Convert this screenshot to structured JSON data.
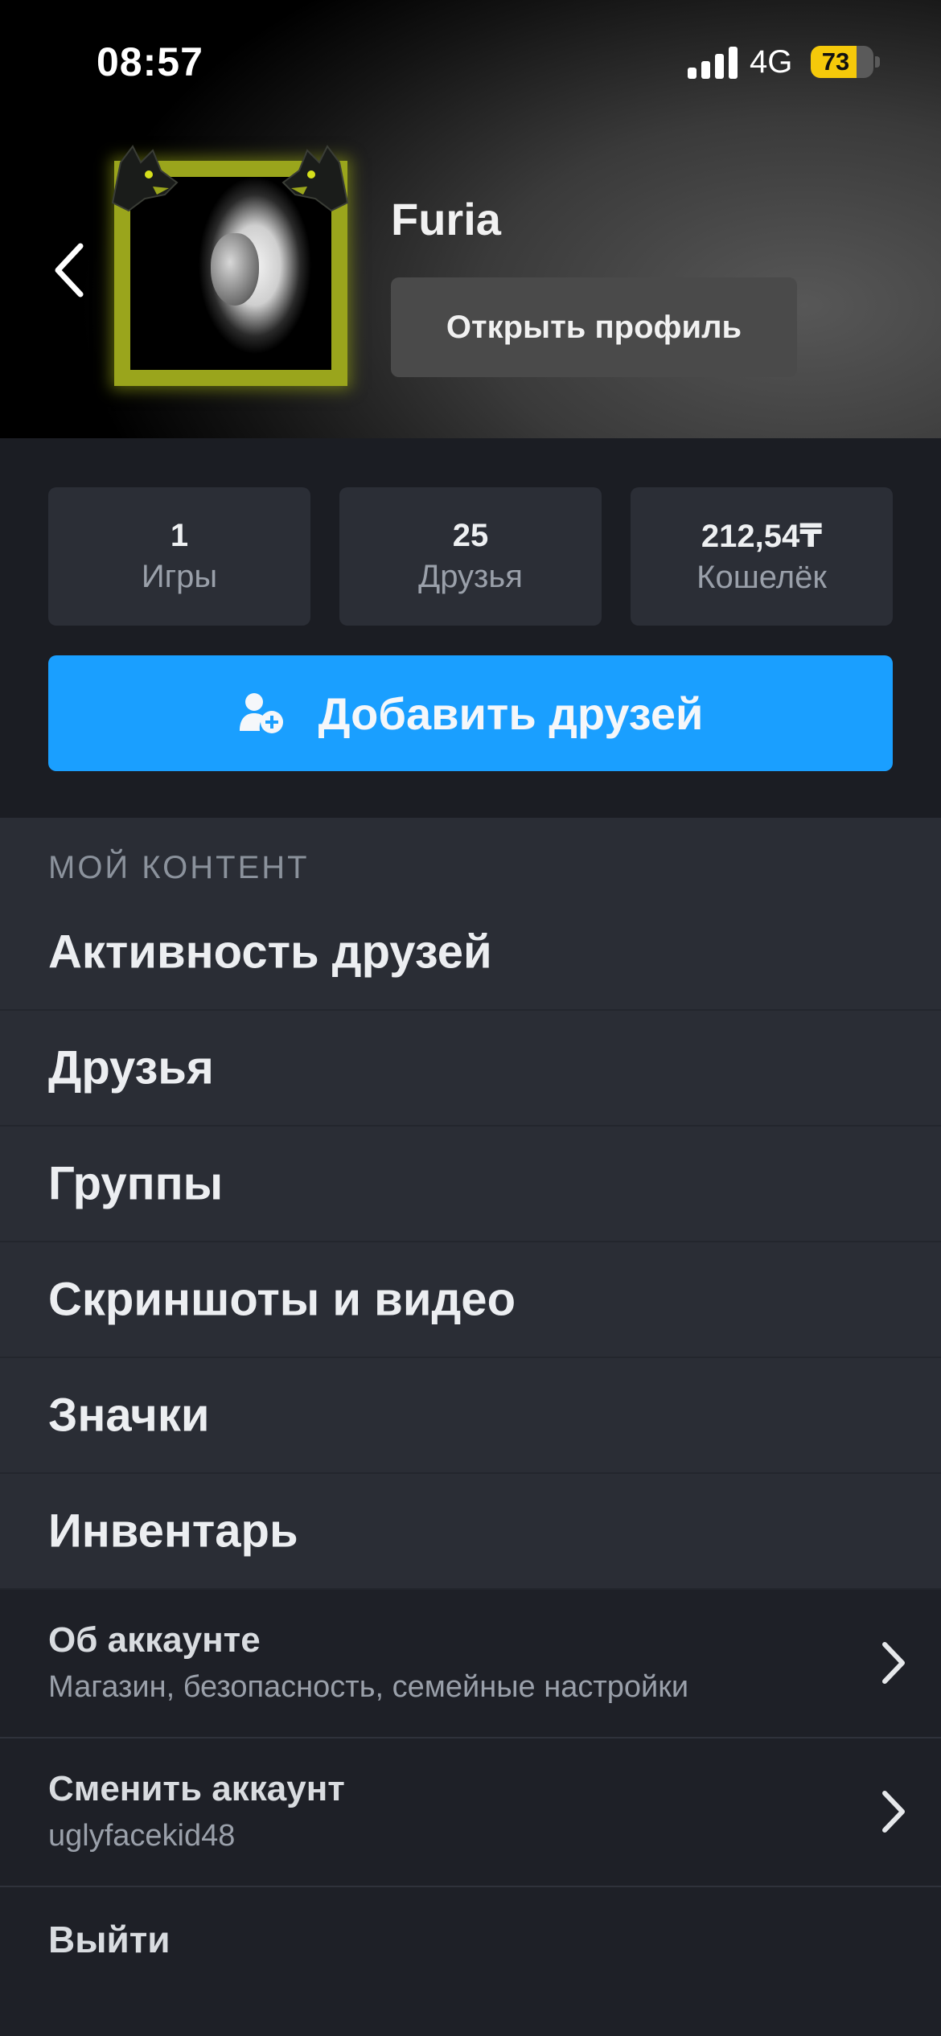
{
  "status_bar": {
    "time": "08:57",
    "network": "4G",
    "battery_percent": "73",
    "battery_level": 0.73
  },
  "profile": {
    "name": "Furia",
    "open_profile_label": "Открыть профиль",
    "frame_color": "#9aa51c"
  },
  "stats": [
    {
      "value": "1",
      "label": "Игры"
    },
    {
      "value": "25",
      "label": "Друзья"
    },
    {
      "value": "212,54₸",
      "label": "Кошелёк"
    }
  ],
  "add_friends": {
    "label": "Добавить друзей",
    "icon": "add-user-icon",
    "color": "#1a9fff"
  },
  "my_content": {
    "title": "МОЙ КОНТЕНТ",
    "items": [
      "Активность друзей",
      "Друзья",
      "Группы",
      "Скриншоты и видео",
      "Значки",
      "Инвентарь"
    ]
  },
  "account": {
    "about_title": "Об аккаунте",
    "about_sub": "Магазин, безопасность, семейные настройки",
    "switch_title": "Сменить аккаунт",
    "switch_sub": "uglyfacekid48",
    "logout": "Выйти"
  }
}
